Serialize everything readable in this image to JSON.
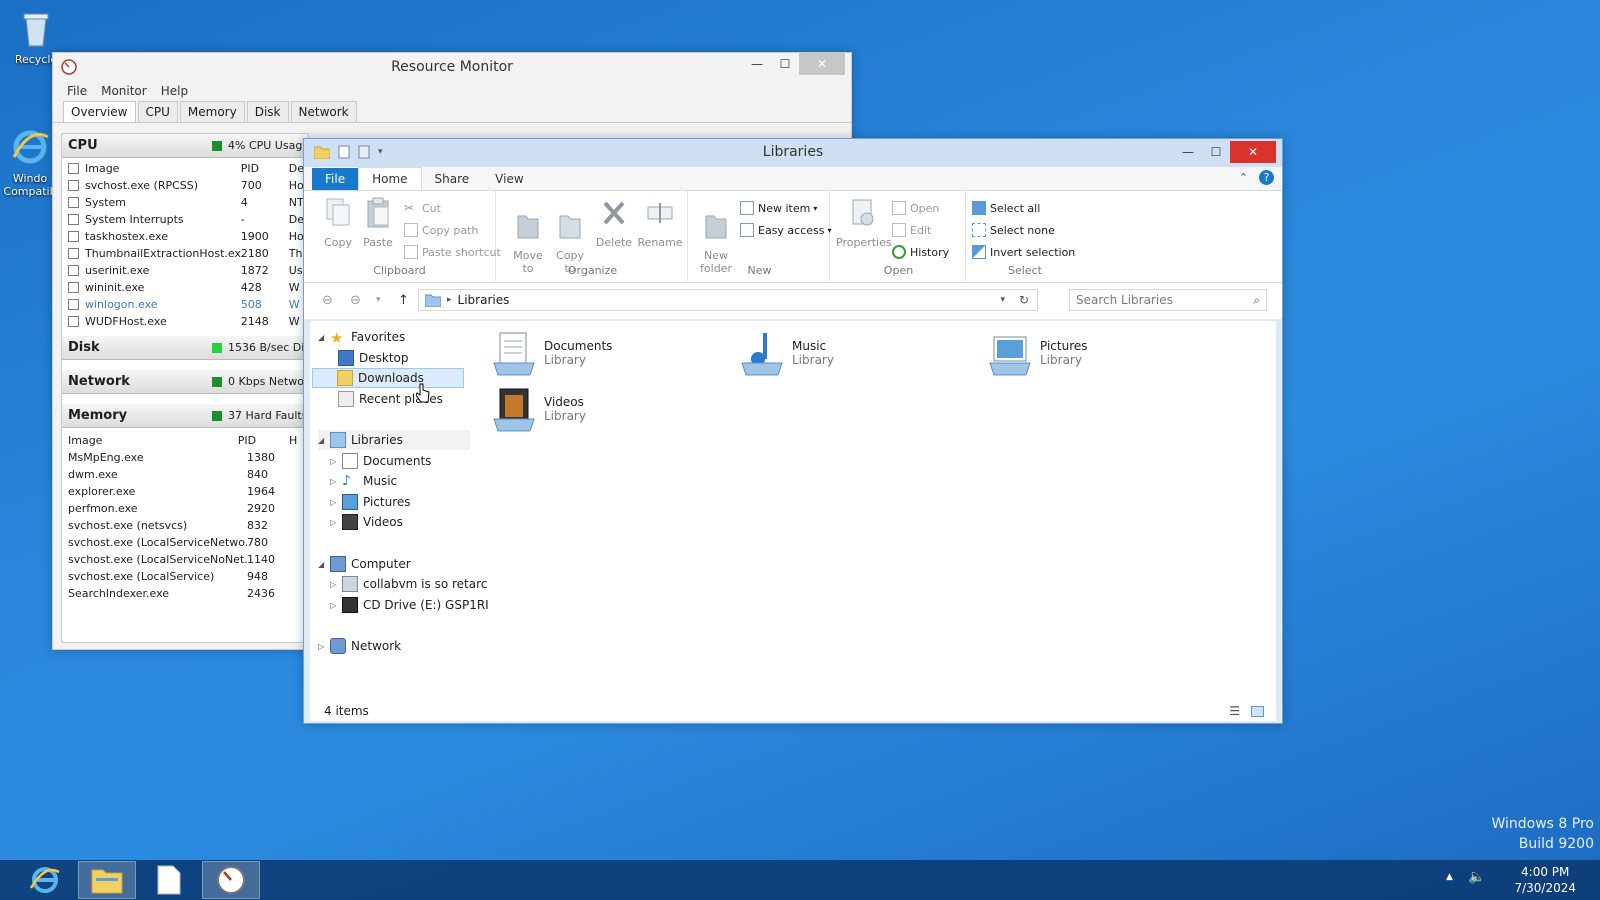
{
  "desktop": {
    "icons": [
      {
        "label": "Recycle",
        "icon": "recycle-bin-icon"
      },
      {
        "label": "Windo\nCompatib",
        "icon": "internet-explorer-icon"
      }
    ],
    "watermark": {
      "line1": "Windows 8 Pro",
      "line2": "Build 9200"
    }
  },
  "taskbar": {
    "time": "4:00 PM",
    "date": "7/30/2024",
    "pinned": [
      "internet-explorer-icon",
      "file-explorer-icon",
      "notepad-icon",
      "resource-monitor-icon"
    ]
  },
  "resource_monitor": {
    "title": "Resource Monitor",
    "menu": [
      "File",
      "Monitor",
      "Help"
    ],
    "tabs": [
      "Overview",
      "CPU",
      "Memory",
      "Disk",
      "Network"
    ],
    "cpu": {
      "label": "CPU",
      "indicator": "4% CPU Usage",
      "headers": [
        "Image",
        "PID",
        "De"
      ],
      "rows": [
        {
          "image": "svchost.exe (RPCSS)",
          "pid": "700",
          "desc": "Ho"
        },
        {
          "image": "System",
          "pid": "4",
          "desc": "NT"
        },
        {
          "image": "System Interrupts",
          "pid": "-",
          "desc": "De"
        },
        {
          "image": "taskhostex.exe",
          "pid": "1900",
          "desc": "Ho"
        },
        {
          "image": "ThumbnailExtractionHost.exe",
          "pid": "2180",
          "desc": "Th"
        },
        {
          "image": "userinit.exe",
          "pid": "1872",
          "desc": "Us"
        },
        {
          "image": "wininit.exe",
          "pid": "428",
          "desc": "W"
        },
        {
          "image": "winlogon.exe",
          "pid": "508",
          "desc": "W"
        },
        {
          "image": "WUDFHost.exe",
          "pid": "2148",
          "desc": "W"
        }
      ]
    },
    "disk": {
      "label": "Disk",
      "indicator": "1536 B/sec Disk"
    },
    "network": {
      "label": "Network",
      "indicator": "0 Kbps Network"
    },
    "memory": {
      "label": "Memory",
      "indicator": "37 Hard Faults/s",
      "headers": [
        "Image",
        "PID",
        "H"
      ],
      "rows": [
        {
          "image": "MsMpEng.exe",
          "pid": "1380"
        },
        {
          "image": "dwm.exe",
          "pid": "840"
        },
        {
          "image": "explorer.exe",
          "pid": "1964"
        },
        {
          "image": "perfmon.exe",
          "pid": "2920"
        },
        {
          "image": "svchost.exe (netsvcs)",
          "pid": "832"
        },
        {
          "image": "svchost.exe (LocalServiceNetwo...",
          "pid": "780"
        },
        {
          "image": "svchost.exe (LocalServiceNoNet...",
          "pid": "1140"
        },
        {
          "image": "svchost.exe (LocalService)",
          "pid": "948"
        },
        {
          "image": "SearchIndexer.exe",
          "pid": "2436"
        }
      ]
    }
  },
  "explorer": {
    "title": "Libraries",
    "ribbon_tabs": [
      "File",
      "Home",
      "Share",
      "View"
    ],
    "ribbon": {
      "clipboard": {
        "label": "Clipboard",
        "copy": "Copy",
        "paste": "Paste",
        "cut": "Cut",
        "copy_path": "Copy path",
        "paste_shortcut": "Paste shortcut"
      },
      "organize": {
        "label": "Organize",
        "move_to": "Move\nto",
        "copy_to": "Copy\nto",
        "delete": "Delete",
        "rename": "Rename"
      },
      "new": {
        "label": "New",
        "new_folder": "New\nfolder",
        "new_item": "New item",
        "easy_access": "Easy access"
      },
      "open": {
        "label": "Open",
        "properties": "Properties",
        "open": "Open",
        "edit": "Edit",
        "history": "History"
      },
      "select": {
        "label": "Select",
        "select_all": "Select all",
        "select_none": "Select none",
        "invert_selection": "Invert selection"
      }
    },
    "address": "Libraries",
    "search_placeholder": "Search Libraries",
    "tree": {
      "favorites": "Favorites",
      "desktop": "Desktop",
      "downloads": "Downloads",
      "recent_places": "Recent places",
      "libraries": "Libraries",
      "lib_documents": "Documents",
      "lib_music": "Music",
      "lib_pictures": "Pictures",
      "lib_videos": "Videos",
      "computer": "Computer",
      "drive_c": "collabvm is so retarc",
      "drive_e": "CD Drive (E:) GSP1RI",
      "network": "Network"
    },
    "items": [
      {
        "name": "Documents",
        "type": "Library"
      },
      {
        "name": "Music",
        "type": "Library"
      },
      {
        "name": "Pictures",
        "type": "Library"
      },
      {
        "name": "Videos",
        "type": "Library"
      }
    ],
    "status": "4 items"
  }
}
